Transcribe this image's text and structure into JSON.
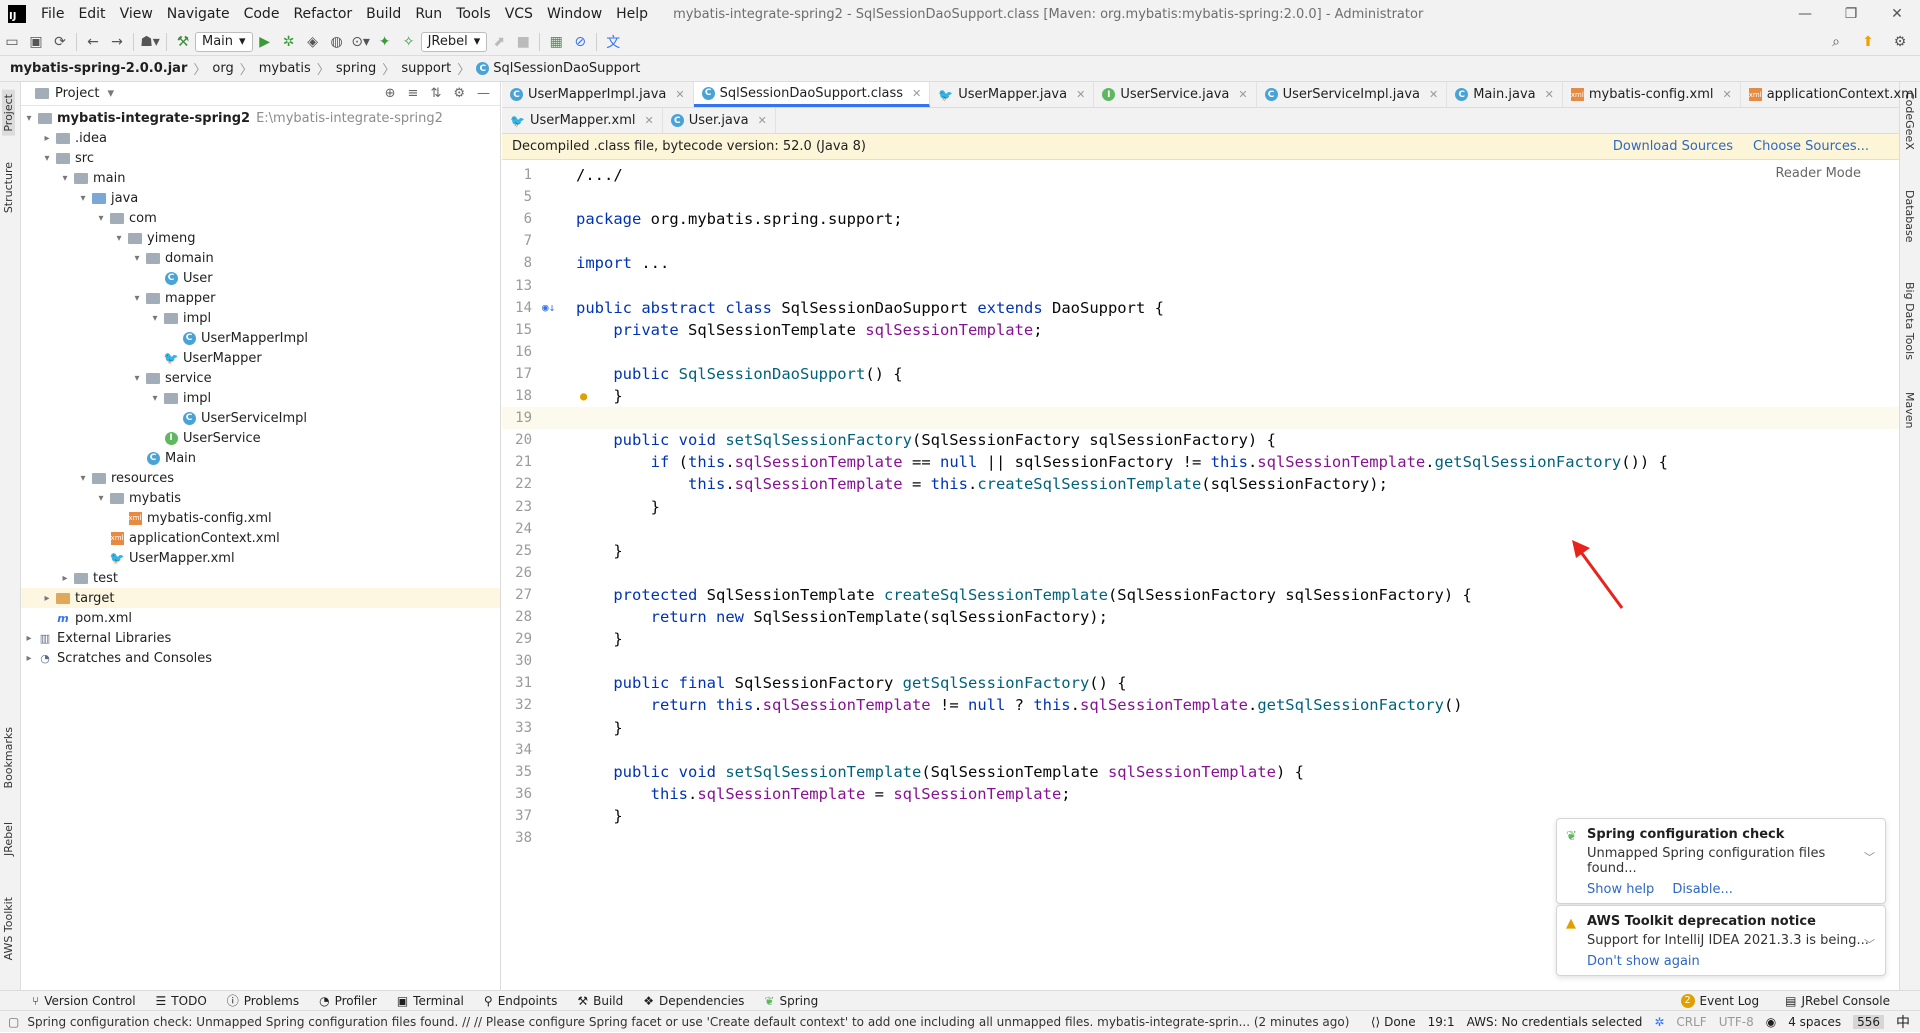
{
  "menubar": {
    "items": [
      "File",
      "Edit",
      "View",
      "Navigate",
      "Code",
      "Refactor",
      "Build",
      "Run",
      "Tools",
      "VCS",
      "Window",
      "Help"
    ],
    "window_title": "mybatis-integrate-spring2 - SqlSessionDaoSupport.class [Maven: org.mybatis:mybatis-spring:2.0.0] - Administrator"
  },
  "toolbar": {
    "run_config": "Main",
    "jrebel": "JRebel"
  },
  "breadcrumb": [
    "mybatis-spring-2.0.0.jar",
    "org",
    "mybatis",
    "spring",
    "support",
    "SqlSessionDaoSupport"
  ],
  "leftstrip": {
    "project": "Project",
    "structure": "Structure",
    "bookmarks": "Bookmarks",
    "jrebel": "JRebel",
    "aws": "AWS Toolkit"
  },
  "rightstrip": {
    "codegeex": "CodeGeeX",
    "database": "Database",
    "bigdata": "Big Data Tools",
    "maven": "Maven"
  },
  "project": {
    "title": "Project",
    "tree": [
      {
        "label": "mybatis-integrate-spring2",
        "extra": "E:\\mybatis-integrate-spring2"
      },
      {
        "label": ".idea"
      },
      {
        "label": "src"
      },
      {
        "label": "main"
      },
      {
        "label": "java"
      },
      {
        "label": "com"
      },
      {
        "label": "yimeng"
      },
      {
        "label": "domain"
      },
      {
        "label": "User"
      },
      {
        "label": "mapper"
      },
      {
        "label": "impl"
      },
      {
        "label": "UserMapperImpl"
      },
      {
        "label": "UserMapper"
      },
      {
        "label": "service"
      },
      {
        "label": "impl"
      },
      {
        "label": "UserServiceImpl"
      },
      {
        "label": "UserService"
      },
      {
        "label": "Main"
      },
      {
        "label": "resources"
      },
      {
        "label": "mybatis"
      },
      {
        "label": "mybatis-config.xml"
      },
      {
        "label": "applicationContext.xml"
      },
      {
        "label": "UserMapper.xml"
      },
      {
        "label": "test"
      },
      {
        "label": "target"
      },
      {
        "label": "pom.xml"
      },
      {
        "label": "External Libraries"
      },
      {
        "label": "Scratches and Consoles"
      }
    ]
  },
  "editor": {
    "tabs_row1": [
      "UserMapperImpl.java",
      "SqlSessionDaoSupport.class",
      "UserMapper.java",
      "UserService.java",
      "UserServiceImpl.java",
      "Main.java",
      "mybatis-config.xml",
      "applicationContext.xml"
    ],
    "tabs_row2": [
      "UserMapper.xml",
      "User.java"
    ],
    "notice": "Decompiled .class file, bytecode version: 52.0 (Java 8)",
    "download_sources": "Download Sources",
    "choose_sources": "Choose Sources...",
    "reader_mode": "Reader Mode",
    "line_numbers": [
      "1",
      "5",
      "6",
      "7",
      "8",
      "13",
      "14",
      "15",
      "16",
      "17",
      "18",
      "19",
      "20",
      "21",
      "22",
      "23",
      "24",
      "25",
      "26",
      "27",
      "28",
      "29",
      "30",
      "31",
      "32",
      "33",
      "34",
      "35",
      "36",
      "37",
      "38"
    ],
    "code": [
      "/.../",
      "",
      "package org.mybatis.spring.support;",
      "",
      "import ...",
      "",
      "public abstract class SqlSessionDaoSupport extends DaoSupport {",
      "    private SqlSessionTemplate sqlSessionTemplate;",
      "",
      "    public SqlSessionDaoSupport() {",
      "    }",
      "",
      "    public void setSqlSessionFactory(SqlSessionFactory sqlSessionFactory) {",
      "        if (this.sqlSessionTemplate == null || sqlSessionFactory != this.sqlSessionTemplate.getSqlSessionFactory()) {",
      "            this.sqlSessionTemplate = this.createSqlSessionTemplate(sqlSessionFactory);",
      "        }",
      "",
      "    }",
      "",
      "    protected SqlSessionTemplate createSqlSessionTemplate(SqlSessionFactory sqlSessionFactory) {",
      "        return new SqlSessionTemplate(sqlSessionFactory);",
      "    }",
      "",
      "    public final SqlSessionFactory getSqlSessionFactory() {",
      "        return this.sqlSessionTemplate != null ? this.sqlSessionTemplate.getSqlSessionFactory()",
      "    }",
      "",
      "    public void setSqlSessionTemplate(SqlSessionTemplate sqlSessionTemplate) {",
      "        this.sqlSessionTemplate = sqlSessionTemplate;",
      "    }",
      ""
    ]
  },
  "notifications": [
    {
      "title": "Spring configuration check",
      "body": "Unmapped Spring configuration files found...",
      "links": [
        "Show help",
        "Disable..."
      ]
    },
    {
      "title": "AWS Toolkit deprecation notice",
      "body": "Support for IntelliJ IDEA 2021.3.3 is being...",
      "links": [
        "Don't show again"
      ]
    }
  ],
  "tooltabs": {
    "left": [
      "Version Control",
      "TODO",
      "Problems",
      "Profiler",
      "Terminal",
      "Endpoints",
      "Build",
      "Dependencies",
      "Spring"
    ],
    "right": [
      "Event Log",
      "JRebel Console"
    ],
    "event_count": "2"
  },
  "statusbar": {
    "message": "Spring configuration check: Unmapped Spring configuration files found. // // Please configure Spring facet or use 'Create default context' to add one including all unmapped files. mybatis-integrate-sprin... (2 minutes ago)",
    "done": "Done",
    "position": "19:1",
    "aws": "AWS: No credentials selected",
    "line_sep": "CRLF",
    "encoding": "UTF-8",
    "indent": "4 spaces",
    "memory": "556",
    "ime": "中"
  }
}
